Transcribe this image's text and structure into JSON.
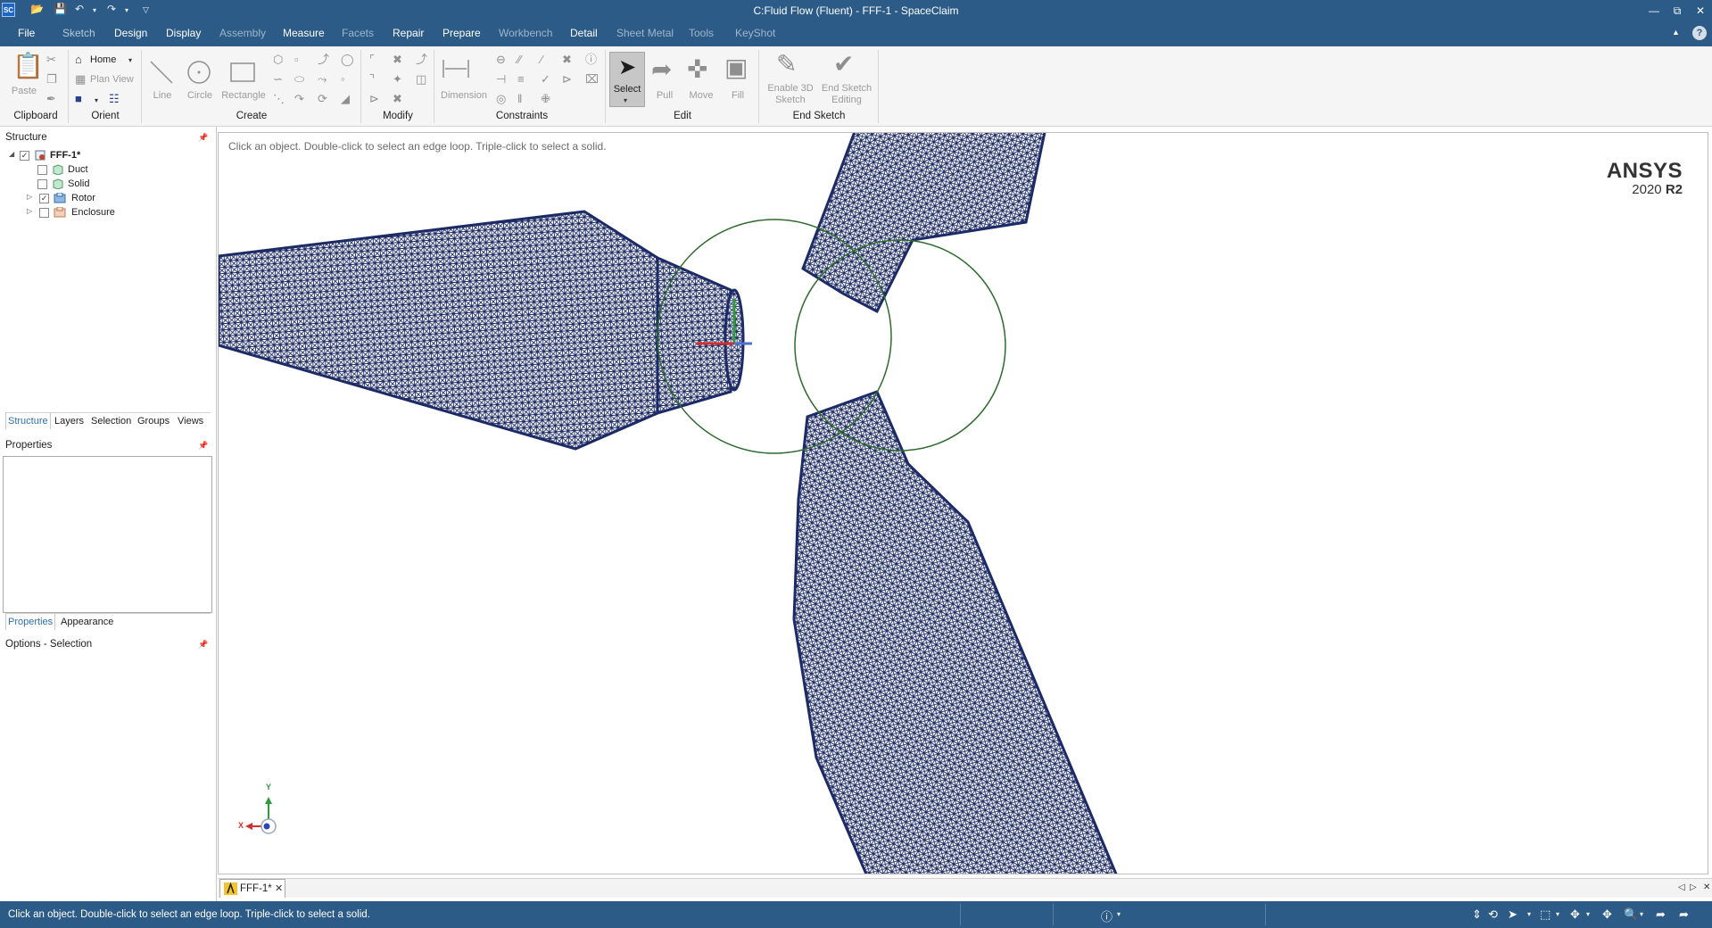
{
  "window": {
    "title": "C:Fluid Flow (Fluent) - FFF-1 - SpaceClaim",
    "logo": "SC"
  },
  "ribbon": {
    "tabs": [
      "File",
      "Sketch",
      "Design",
      "Display",
      "Assembly",
      "Measure",
      "Facets",
      "Repair",
      "Prepare",
      "Workbench",
      "Detail",
      "Sheet Metal",
      "Tools",
      "KeyShot"
    ],
    "groups": {
      "clipboard": "Clipboard",
      "orient": "Orient",
      "create": "Create",
      "modify": "Modify",
      "constraints": "Constraints",
      "edit": "Edit",
      "end_sketch": "End Sketch"
    },
    "buttons": {
      "paste": "Paste",
      "home": "Home",
      "plan_view": "Plan View",
      "line": "Line",
      "circle": "Circle",
      "rectangle": "Rectangle",
      "dimension": "Dimension",
      "select": "Select",
      "pull": "Pull",
      "move": "Move",
      "fill": "Fill",
      "enable_3d_sketch_l1": "Enable 3D",
      "enable_3d_sketch_l2": "Sketch",
      "end_sketch_editing_l1": "End Sketch",
      "end_sketch_editing_l2": "Editing"
    }
  },
  "structure": {
    "header": "Structure",
    "root": "FFF-1*",
    "items": [
      {
        "label": "Duct",
        "checked": false,
        "expandable": false
      },
      {
        "label": "Solid",
        "checked": false,
        "expandable": false
      },
      {
        "label": "Rotor",
        "checked": true,
        "expandable": true
      },
      {
        "label": "Enclosure",
        "checked": false,
        "expandable": true
      }
    ],
    "tabs": [
      "Structure",
      "Layers",
      "Selection",
      "Groups",
      "Views"
    ]
  },
  "properties": {
    "header": "Properties",
    "tabs": [
      "Properties",
      "Appearance"
    ]
  },
  "options": {
    "header": "Options - Selection"
  },
  "viewport": {
    "hint": "Click an object. Double-click to select an edge loop. Triple-click to select a solid.",
    "brand_name": "ANSYS",
    "brand_year": "2020",
    "brand_release": "R2",
    "triad_x": "X",
    "triad_y": "Y"
  },
  "doc_tabs": [
    {
      "label": "FFF-1*"
    }
  ],
  "status": {
    "message": "Click an object. Double-click to select an edge loop. Triple-click to select a solid."
  },
  "colors": {
    "chrome": "#2b5b86",
    "mesh": "#1c2a66",
    "sketch_circle": "#2d6a2d"
  }
}
